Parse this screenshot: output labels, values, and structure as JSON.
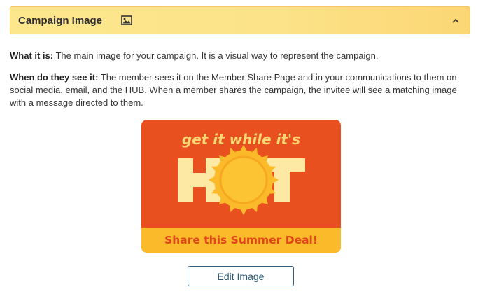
{
  "panel": {
    "title": "Campaign Image",
    "title_icon": "image-icon",
    "collapse_icon": "chevron-up-icon"
  },
  "description": {
    "what_label": "What it is:",
    "what_text": " The main image for your campaign. It is a visual way to represent the campaign.",
    "when_label": "When do they see it:",
    "when_text": " The member sees it on the Member Share Page and in your communications to them on social media, email, and the HUB. When a member shares the campaign, the invitee will see a matching image with a message directed to them."
  },
  "campaign_image": {
    "tagline": "get it while it's",
    "headline": "HOT",
    "banner": "Share this Summer Deal!",
    "colors": {
      "background": "#e8511f",
      "letters": "#fde9a4",
      "sun": "#fbba2a",
      "banner": "#fbba2a",
      "banner_text": "#e0441a"
    }
  },
  "actions": {
    "edit_label": "Edit Image"
  }
}
